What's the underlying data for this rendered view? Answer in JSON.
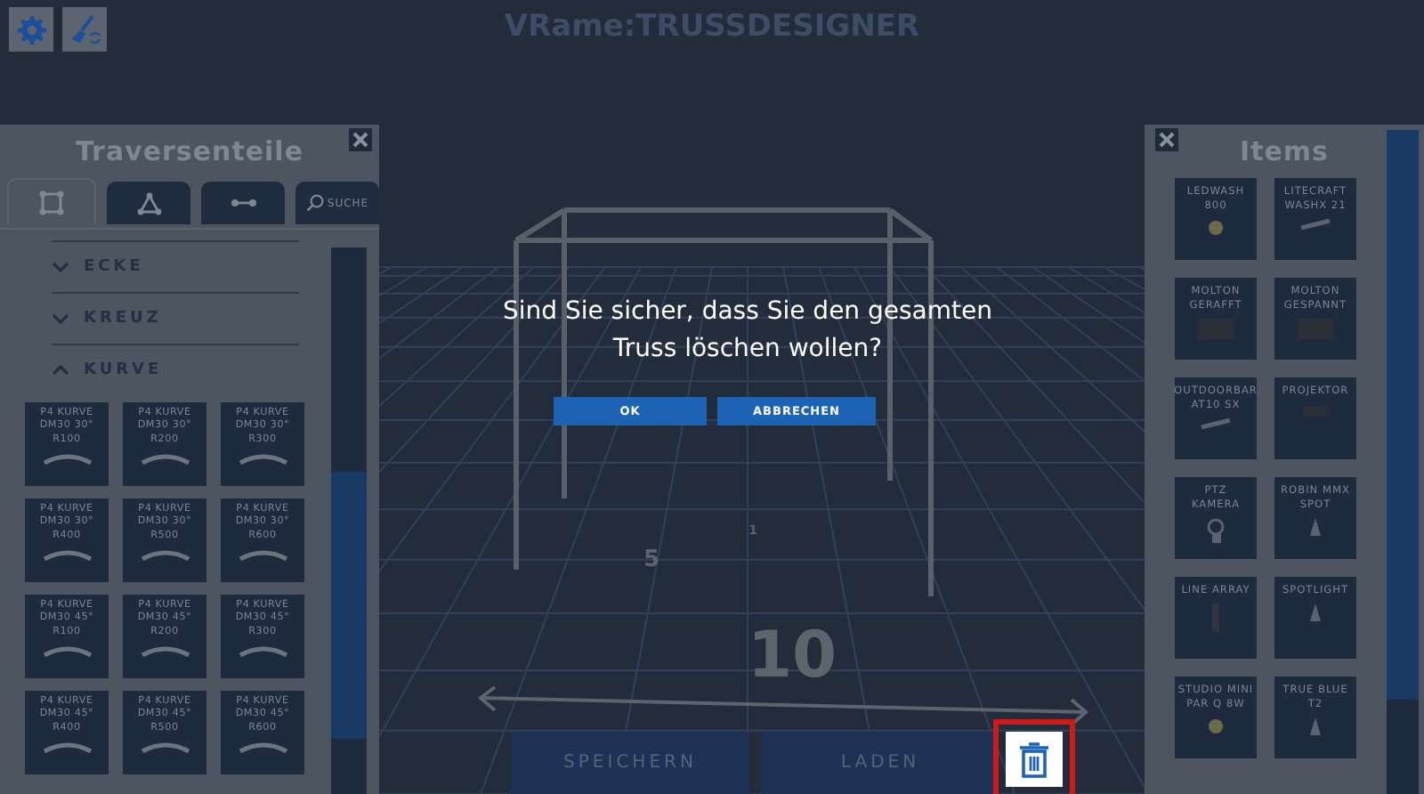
{
  "toolbar": {
    "buttons": [
      {
        "kind": "settings"
      },
      {
        "kind": "brush"
      }
    ]
  },
  "logo": "VRame:**TRUSSDESIGNER**",
  "scene": {
    "labels": [
      "5",
      "1",
      "10"
    ]
  },
  "left_panel": {
    "title": "Traversenteile",
    "tabs": [
      {
        "kind": "square",
        "selected": true
      },
      {
        "kind": "triangle",
        "selected": false
      },
      {
        "kind": "line",
        "selected": false
      },
      {
        "kind": "search",
        "label": "SUCHE",
        "selected": false
      }
    ],
    "categories": [
      {
        "label": "ECKE",
        "expanded": false
      },
      {
        "label": "KREUZ",
        "expanded": false
      },
      {
        "label": "KURVE",
        "expanded": true,
        "tiles": [
          {
            "line1": "P4 KURVE",
            "line2": "DM30 30°",
            "line3": "R100"
          },
          {
            "line1": "P4 KURVE",
            "line2": "DM30 30°",
            "line3": "R200"
          },
          {
            "line1": "P4 KURVE",
            "line2": "DM30 30°",
            "line3": "R300"
          },
          {
            "line1": "P4 KURVE",
            "line2": "DM30 30°",
            "line3": "R400"
          },
          {
            "line1": "P4 KURVE",
            "line2": "DM30 30°",
            "line3": "R500"
          },
          {
            "line1": "P4 KURVE",
            "line2": "DM30 30°",
            "line3": "R600"
          },
          {
            "line1": "P4 KURVE",
            "line2": "DM30 45°",
            "line3": "R100"
          },
          {
            "line1": "P4 KURVE",
            "line2": "DM30 45°",
            "line3": "R200"
          },
          {
            "line1": "P4 KURVE",
            "line2": "DM30 45°",
            "line3": "R300"
          },
          {
            "line1": "P4 KURVE",
            "line2": "DM30 45°",
            "line3": "R400"
          },
          {
            "line1": "P4 KURVE",
            "line2": "DM30 45°",
            "line3": "R500"
          },
          {
            "line1": "P4 KURVE",
            "line2": "DM30 45°",
            "line3": "R600"
          }
        ]
      }
    ]
  },
  "right_panel": {
    "title": "Items",
    "items": [
      {
        "line1": "LEDWASH",
        "line2": "800",
        "kind": "round"
      },
      {
        "line1": "LITECRAFT",
        "line2": "WASHX 21",
        "kind": "bar"
      },
      {
        "line1": "MOLTON",
        "line2": "GERAFFT",
        "kind": "curtain"
      },
      {
        "line1": "MOLTON",
        "line2": "GESPANNT",
        "kind": "curtain"
      },
      {
        "line1": "OUTDOORBAR",
        "line2": "AT10 SX",
        "kind": "bar"
      },
      {
        "line1": "PROJEKTOR",
        "kind": "box"
      },
      {
        "line1": "PTZ",
        "line2": "KAMERA",
        "kind": "camera"
      },
      {
        "line1": "ROBIN MMX",
        "line2": "SPOT",
        "kind": "spot"
      },
      {
        "line1": "LINE ARRAY",
        "kind": "array"
      },
      {
        "line1": "SPOTLIGHT",
        "kind": "spot"
      },
      {
        "line1": "STUDIO MINI",
        "line2": "PAR Q 8W",
        "kind": "round"
      },
      {
        "line1": "TRUE BLUE",
        "line2": "T2",
        "kind": "spot"
      }
    ]
  },
  "dialog": {
    "message": "Sind Sie sicher, dass Sie den gesamten Truss löschen wollen?",
    "buttons": [
      "OK",
      "ABBRECHEN"
    ]
  },
  "bottom_bar": {
    "buttons": [
      "SPEICHERN",
      "LADEN"
    ],
    "delete_highlighted": true
  }
}
